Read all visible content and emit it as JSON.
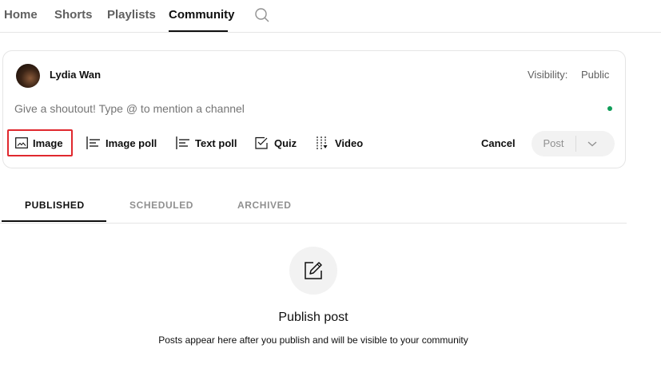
{
  "nav": {
    "tabs": [
      {
        "label": "Home"
      },
      {
        "label": "Shorts"
      },
      {
        "label": "Playlists"
      },
      {
        "label": "Community"
      }
    ],
    "active_tab": "Community"
  },
  "composer": {
    "author_name": "Lydia Wan",
    "visibility_label": "Visibility:",
    "visibility_value": "Public",
    "placeholder": "Give a shoutout! Type @ to mention a channel",
    "tools": [
      {
        "label": "Image",
        "icon": "image-icon"
      },
      {
        "label": "Image poll",
        "icon": "list-icon"
      },
      {
        "label": "Text poll",
        "icon": "list-icon"
      },
      {
        "label": "Quiz",
        "icon": "checkbox-icon"
      },
      {
        "label": "Video",
        "icon": "video-icon"
      }
    ],
    "cancel_label": "Cancel",
    "post_label": "Post"
  },
  "subtabs": {
    "items": [
      {
        "label": "PUBLISHED"
      },
      {
        "label": "SCHEDULED"
      },
      {
        "label": "ARCHIVED"
      }
    ],
    "active": "PUBLISHED"
  },
  "empty_state": {
    "title": "Publish post",
    "description": "Posts appear here after you publish and will be visible to your community"
  },
  "colors": {
    "highlight_border": "#e0282e",
    "status_dot": "#0f9d58"
  }
}
